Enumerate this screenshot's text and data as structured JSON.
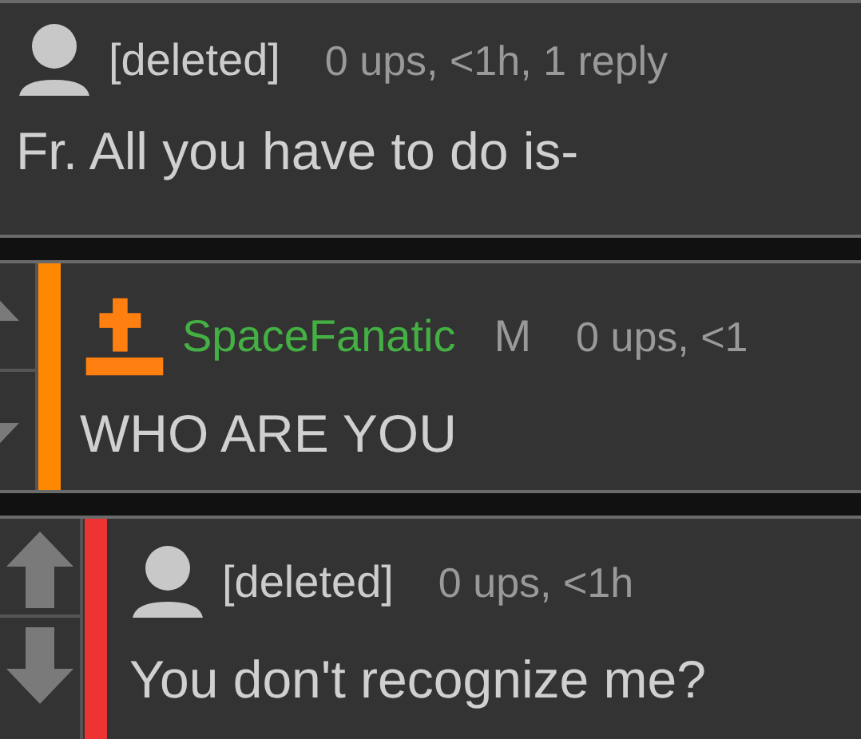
{
  "comments": [
    {
      "author": {
        "name": "[deleted]",
        "kind": "deleted"
      },
      "meta": "0 ups, <1h, 1 reply",
      "text": "Fr. All you have to do is-",
      "children": [
        {
          "author": {
            "name": "SpaceFanatic",
            "kind": "user",
            "badge": "M"
          },
          "meta": "0 ups, <1",
          "text": "WHO ARE YOU",
          "color": "#ff8800",
          "children": [
            {
              "author": {
                "name": "[deleted]",
                "kind": "deleted"
              },
              "meta": "0 ups, <1h",
              "text": "You don't recognize me?",
              "color": "#ee3333"
            }
          ]
        }
      ]
    }
  ]
}
